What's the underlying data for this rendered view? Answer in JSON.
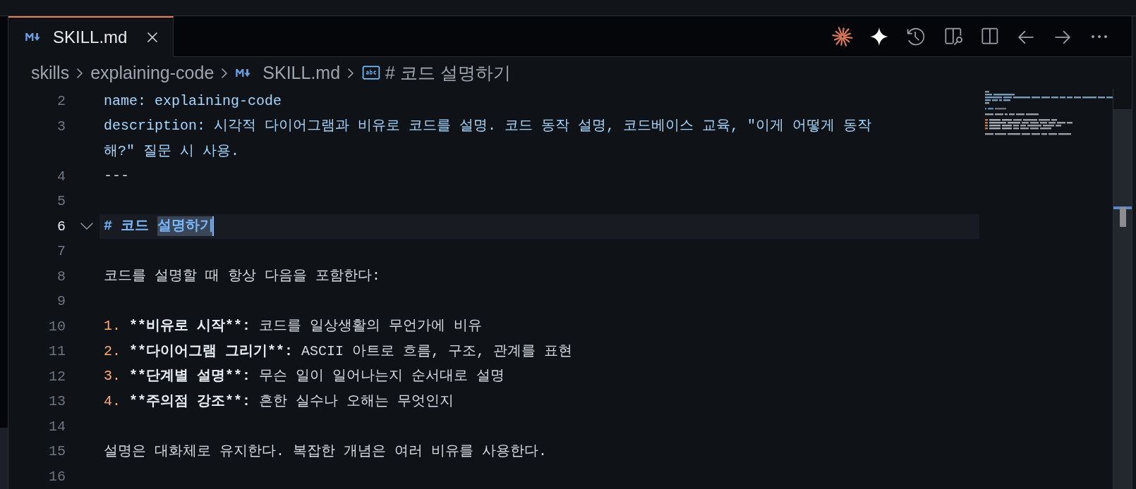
{
  "tabs": [
    {
      "label": "SKILL.md",
      "selected": true
    }
  ],
  "breadcrumbs": [
    {
      "label": "skills",
      "kind": "folder"
    },
    {
      "label": "explaining-code",
      "kind": "folder"
    },
    {
      "label": "SKILL.md",
      "kind": "markdown"
    },
    {
      "label": "# 코드 설명하기",
      "kind": "string"
    }
  ],
  "editor": {
    "lines": [
      {
        "number": "2",
        "current": false,
        "rows": [
          [
            {
              "kind": "frontmatter",
              "text": "name: explaining-code"
            }
          ]
        ]
      },
      {
        "number": "3",
        "current": false,
        "rows": [
          [
            {
              "kind": "frontmatter",
              "text": "description: 시각적 다이어그램과 비유로 코드를 설명. 코드 동작 설명, 코드베이스 교육, \"이게 어떻게 동작"
            }
          ],
          [
            {
              "kind": "frontmatter",
              "text": "해?\" 질문 시 사용."
            }
          ]
        ]
      },
      {
        "number": "4",
        "current": false,
        "rows": [
          [
            {
              "kind": "delimiter",
              "text": "---"
            }
          ]
        ]
      },
      {
        "number": "5",
        "current": false
      },
      {
        "number": "6",
        "current": true,
        "fold": {
          "expanded": true
        },
        "rows": [
          [
            {
              "kind": "heading",
              "text": "# 코드",
              "selected": false
            },
            {
              "kind": "heading",
              "text": "설명하기",
              "selected": true
            }
          ]
        ]
      },
      {
        "number": "7",
        "current": false
      },
      {
        "number": "8",
        "current": false,
        "rows": [
          [
            {
              "kind": "text",
              "text": "코드를 설명할 때 항상 다음을 포함한다:"
            }
          ]
        ]
      },
      {
        "number": "9",
        "current": false
      },
      {
        "number": "10",
        "current": false,
        "rows": [
          [
            {
              "kind": "list_marker",
              "text": "1."
            },
            {
              "kind": "strong",
              "text": "**비유로 시작**:"
            },
            {
              "kind": "text",
              "text": "코드를 일상생활의 무언가에 비유"
            }
          ]
        ]
      },
      {
        "number": "11",
        "current": false,
        "rows": [
          [
            {
              "kind": "list_marker",
              "text": "2."
            },
            {
              "kind": "strong",
              "text": "**다이어그램 그리기**:"
            },
            {
              "kind": "text",
              "text": "ASCII 아트로 흐름, 구조, 관계를 표현"
            }
          ]
        ]
      },
      {
        "number": "12",
        "current": false,
        "rows": [
          [
            {
              "kind": "list_marker",
              "text": "3."
            },
            {
              "kind": "strong",
              "text": "**단계별 설명**:"
            },
            {
              "kind": "text",
              "text": "무슨 일이 일어나는지 순서대로 설명"
            }
          ]
        ]
      },
      {
        "number": "13",
        "current": false,
        "rows": [
          [
            {
              "kind": "list_marker",
              "text": "4."
            },
            {
              "kind": "strong",
              "text": "**주의점 강조**:"
            },
            {
              "kind": "text",
              "text": "흔한 실수나 오해는 무엇인지"
            }
          ]
        ]
      },
      {
        "number": "14",
        "current": false
      },
      {
        "number": "15",
        "current": false,
        "rows": [
          [
            {
              "kind": "text",
              "text": "설명은 대화체로 유지한다. 복잡한 개념은 여러 비유를 사용한다."
            }
          ]
        ]
      },
      {
        "number": "16",
        "current": false
      }
    ]
  }
}
